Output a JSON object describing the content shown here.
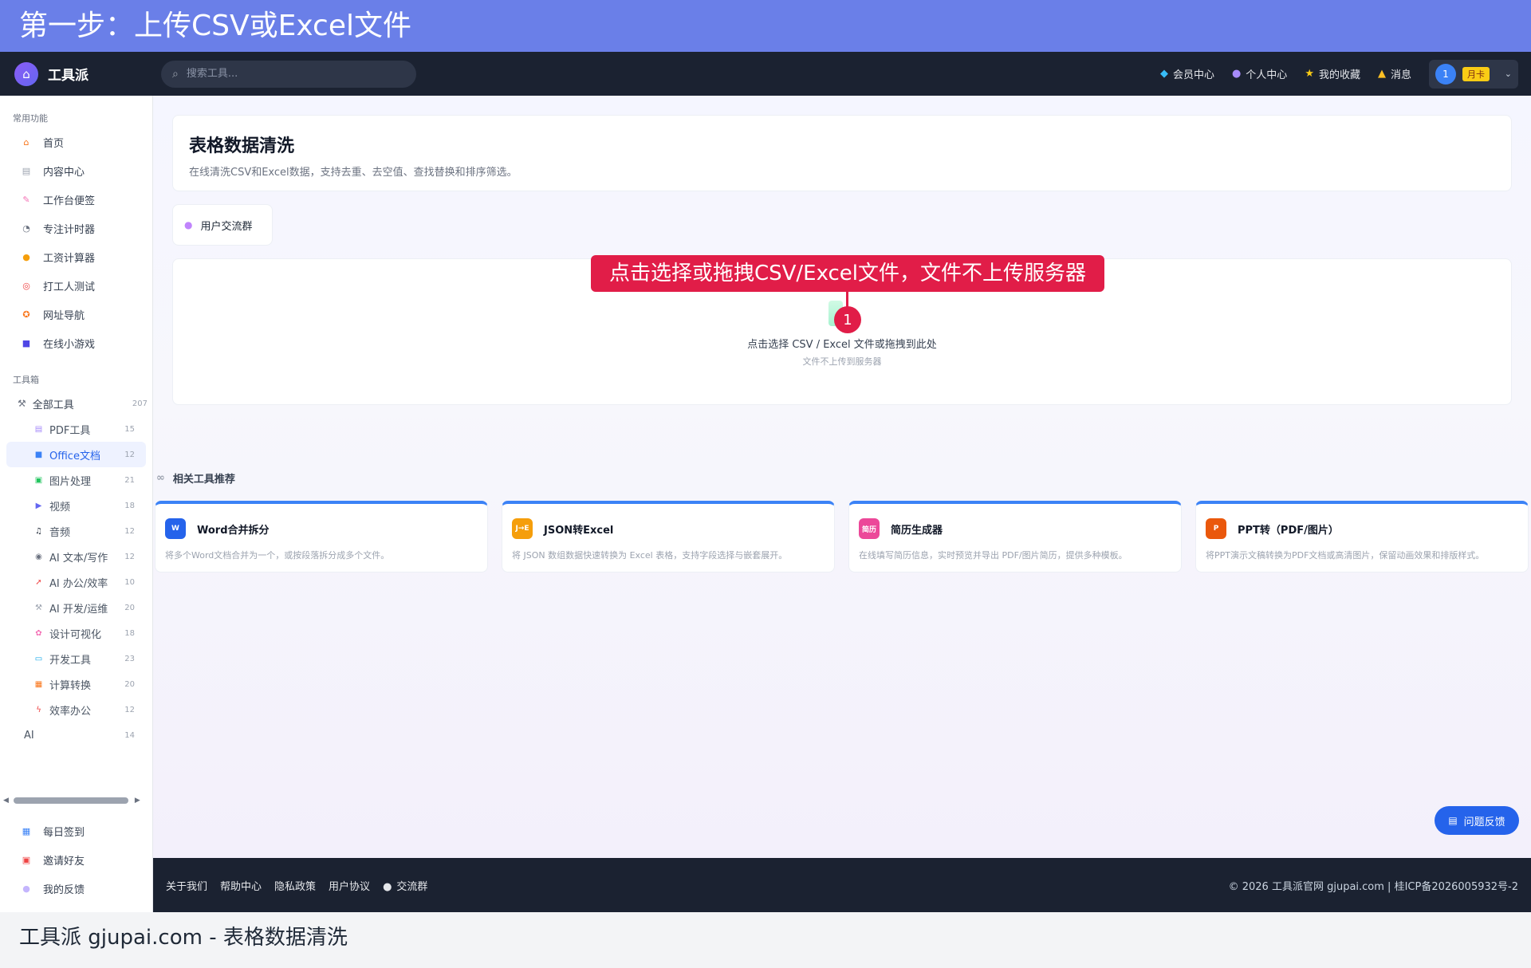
{
  "banner": {
    "text": "第一步：上传CSV或Excel文件"
  },
  "navbar": {
    "brand": "工具派",
    "search_placeholder": "搜索工具...",
    "links": [
      {
        "label": "会员中心",
        "icon": "diamond-icon"
      },
      {
        "label": "个人中心",
        "icon": "user-icon"
      },
      {
        "label": "我的收藏",
        "icon": "star-icon"
      },
      {
        "label": "消息",
        "icon": "bell-icon"
      }
    ],
    "user": {
      "avatar": "1",
      "badge": "月卡"
    }
  },
  "sidebar": {
    "common_title": "常用功能",
    "common": [
      {
        "label": "首页",
        "icon": "home-icon"
      },
      {
        "label": "内容中心",
        "icon": "newspaper-icon"
      },
      {
        "label": "工作台便签",
        "icon": "memo-icon"
      },
      {
        "label": "专注计时器",
        "icon": "timer-icon"
      },
      {
        "label": "工资计算器",
        "icon": "money-bag-icon"
      },
      {
        "label": "打工人测试",
        "icon": "target-icon"
      },
      {
        "label": "网址导航",
        "icon": "compass-icon"
      },
      {
        "label": "在线小游戏",
        "icon": "gamepad-icon"
      }
    ],
    "toolbox_title": "工具箱",
    "all_tools": {
      "label": "全部工具",
      "count": "207"
    },
    "tools": [
      {
        "label": "PDF工具",
        "count": "15",
        "icon": "pdf-icon"
      },
      {
        "label": "Office文档",
        "count": "12",
        "icon": "office-icon",
        "active": true
      },
      {
        "label": "图片处理",
        "count": "21",
        "icon": "image-icon"
      },
      {
        "label": "视频",
        "count": "18",
        "icon": "video-icon"
      },
      {
        "label": "音频",
        "count": "12",
        "icon": "music-icon"
      },
      {
        "label": "AI 文本/写作",
        "count": "12",
        "icon": "robot-icon"
      },
      {
        "label": "AI 办公/效率",
        "count": "10",
        "icon": "rocket-icon"
      },
      {
        "label": "AI 开发/运维",
        "count": "20",
        "icon": "wrench-icon"
      },
      {
        "label": "设计可视化",
        "count": "18",
        "icon": "palette-icon"
      },
      {
        "label": "开发工具",
        "count": "23",
        "icon": "laptop-icon"
      },
      {
        "label": "计算转换",
        "count": "20",
        "icon": "calculator-icon"
      },
      {
        "label": "效率办公",
        "count": "12",
        "icon": "lightning-icon"
      },
      {
        "label": "AI",
        "count": "14",
        "icon": ""
      }
    ],
    "bottom": [
      {
        "label": "每日签到",
        "icon": "calendar-icon"
      },
      {
        "label": "邀请好友",
        "icon": "gift-icon"
      },
      {
        "label": "我的反馈",
        "icon": "chat-icon"
      }
    ]
  },
  "main": {
    "title": "表格数据清洗",
    "subtitle": "在线清洗CSV和Excel数据，支持去重、去空值、查找替换和排序筛选。",
    "group_button": "用户交流群",
    "upload": {
      "main": "点击选择 CSV / Excel 文件或拖拽到此处",
      "sub": "文件不上传到服务器"
    },
    "callout": {
      "text": "点击选择或拖拽CSV/Excel文件，文件不上传服务器",
      "number": "1"
    },
    "related_title": "相关工具推荐",
    "related": [
      {
        "name": "Word合并拆分",
        "desc": "将多个Word文档合并为一个，或按段落拆分成多个文件。",
        "icon_text": "W",
        "color": "#2563eb"
      },
      {
        "name": "JSON转Excel",
        "desc": "将 JSON 数组数据快速转换为 Excel 表格，支持字段选择与嵌套展开。",
        "icon_text": "J→E",
        "color": "#f59e0b"
      },
      {
        "name": "简历生成器",
        "desc": "在线填写简历信息，实时预览并导出 PDF/图片简历，提供多种模板。",
        "icon_text": "简历",
        "color": "#ec4899"
      },
      {
        "name": "PPT转（PDF/图片）",
        "desc": "将PPT演示文稿转换为PDF文档或高清图片，保留动画效果和排版样式。",
        "icon_text": "P",
        "color": "#ea580c"
      }
    ],
    "feedback": "问题反馈"
  },
  "footer": {
    "links": [
      "关于我们",
      "帮助中心",
      "隐私政策",
      "用户协议",
      "交流群"
    ],
    "copyright": "© 2026 工具派官网 gjupai.com | 桂ICP备2026005932号-2"
  },
  "caption": "工具派 gjupai.com - 表格数据清洗"
}
